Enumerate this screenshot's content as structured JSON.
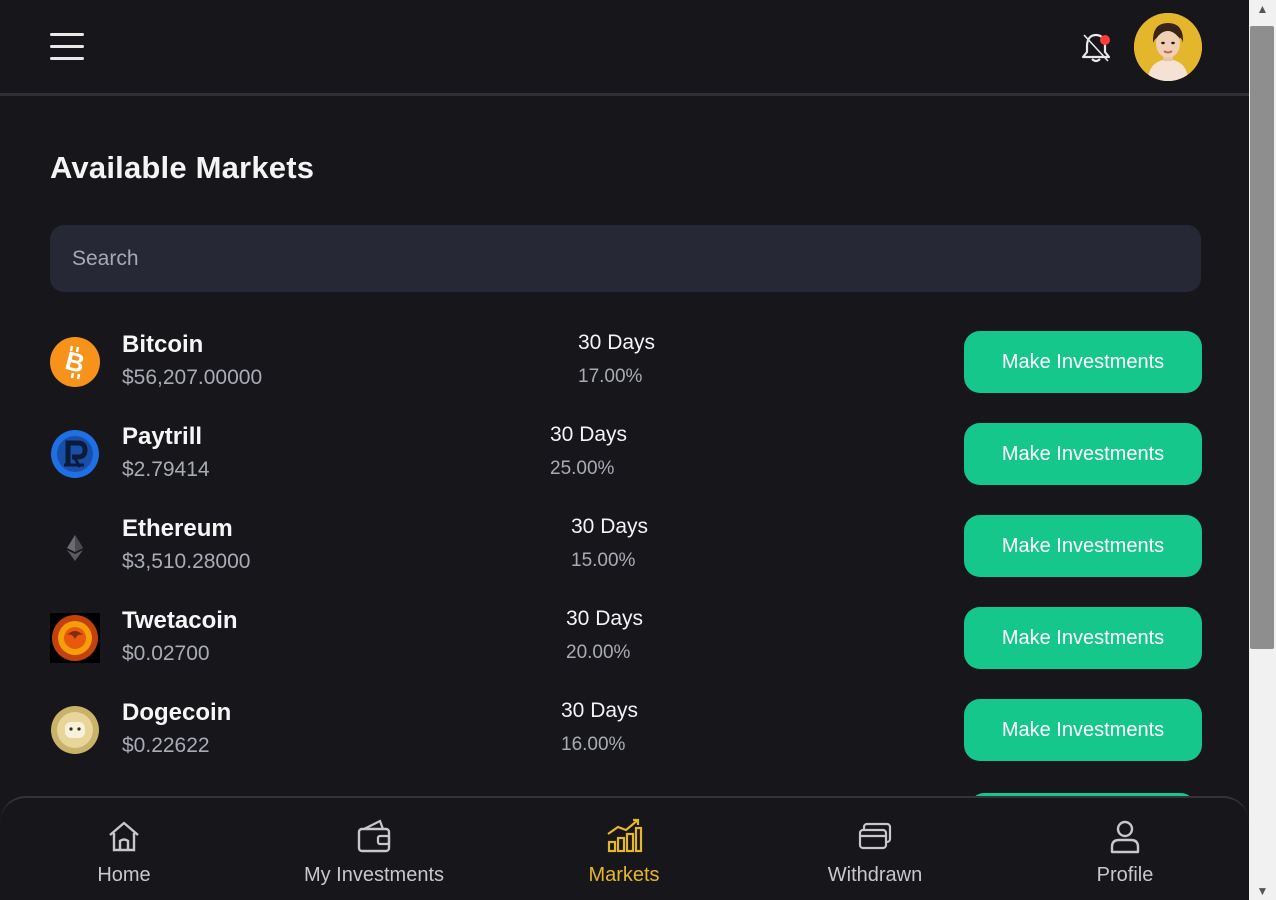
{
  "page": {
    "title": "Available Markets"
  },
  "header": {
    "menu_icon": "hamburger-menu-icon",
    "notification_icon": "bell-icon",
    "notification_dot_color": "#ff3b3b",
    "avatar": "profile-avatar"
  },
  "search": {
    "placeholder": "Search",
    "value": ""
  },
  "markets": [
    {
      "name": "Bitcoin",
      "price": "$56,207.00000",
      "term": "30 Days",
      "rate": "17.00%",
      "button": "Make Investments",
      "icon": "bitcoin-icon"
    },
    {
      "name": "Paytrill",
      "price": "$2.79414",
      "term": "30 Days",
      "rate": "25.00%",
      "button": "Make Investments",
      "icon": "paytrill-icon"
    },
    {
      "name": "Ethereum",
      "price": "$3,510.28000",
      "term": "30 Days",
      "rate": "15.00%",
      "button": "Make Investments",
      "icon": "ethereum-icon"
    },
    {
      "name": "Twetacoin",
      "price": "$0.02700",
      "term": "30 Days",
      "rate": "20.00%",
      "button": "Make Investments",
      "icon": "twetacoin-icon"
    },
    {
      "name": "Dogecoin",
      "price": "$0.22622",
      "term": "30 Days",
      "rate": "16.00%",
      "button": "Make Investments",
      "icon": "dogecoin-icon"
    }
  ],
  "bottom_nav": [
    {
      "label": "Home",
      "icon": "home-icon",
      "active": false
    },
    {
      "label": "My Investments",
      "icon": "wallet-icon",
      "active": false
    },
    {
      "label": "Markets",
      "icon": "chart-icon",
      "active": true
    },
    {
      "label": "Withdrawn",
      "icon": "cards-icon",
      "active": false
    },
    {
      "label": "Profile",
      "icon": "user-icon",
      "active": false
    }
  ],
  "colors": {
    "background": "#16161b",
    "accent_green": "#16c78b",
    "active_gold": "#e3b62c",
    "search_bg": "#262835",
    "muted_text": "#a9abb5"
  }
}
